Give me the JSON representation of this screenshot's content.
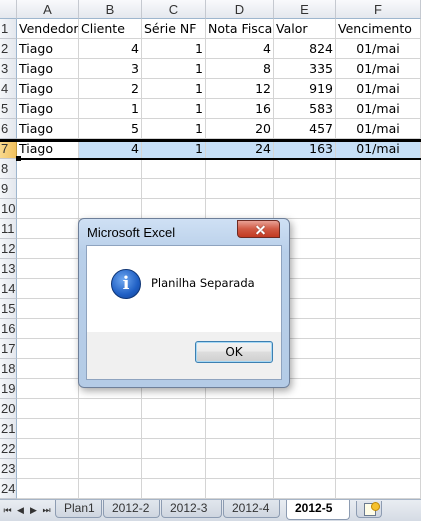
{
  "sheet": {
    "columns": [
      "A",
      "B",
      "C",
      "D",
      "E",
      "F"
    ],
    "row_numbers": [
      "1",
      "2",
      "3",
      "4",
      "5",
      "6",
      "7",
      "8",
      "9",
      "10",
      "11",
      "12",
      "13",
      "14",
      "15",
      "16",
      "17",
      "18",
      "19",
      "20",
      "21",
      "22",
      "23",
      "24"
    ],
    "header_row": [
      "Vendedor",
      "Cliente",
      "Série NF",
      "Nota Fisca",
      "Valor",
      "Vencimento"
    ],
    "data_rows": [
      [
        "Tiago",
        "4",
        "1",
        "4",
        "824",
        "01/mai"
      ],
      [
        "Tiago",
        "3",
        "1",
        "8",
        "335",
        "01/mai"
      ],
      [
        "Tiago",
        "2",
        "1",
        "12",
        "919",
        "01/mai"
      ],
      [
        "Tiago",
        "1",
        "1",
        "16",
        "583",
        "01/mai"
      ],
      [
        "Tiago",
        "5",
        "1",
        "20",
        "457",
        "01/mai"
      ],
      [
        "Tiago",
        "4",
        "1",
        "24",
        "163",
        "01/mai"
      ]
    ],
    "selected_row": "7",
    "selection_color": "#c6dff7"
  },
  "tabs": {
    "nav_icons": [
      "first-sheet-icon",
      "prev-sheet-icon",
      "next-sheet-icon",
      "last-sheet-icon"
    ],
    "nav_glyphs": [
      "⏮",
      "◀",
      "▶",
      "⏭"
    ],
    "items": [
      {
        "label": "Plan1",
        "active": false
      },
      {
        "label": "2012-2",
        "active": false
      },
      {
        "label": "2012-3",
        "active": false
      },
      {
        "label": "2012-4",
        "active": false
      },
      {
        "label": "2012-5",
        "active": true
      }
    ],
    "new_sheet_icon": "insert-worksheet-icon"
  },
  "dialog": {
    "title": "Microsoft Excel",
    "icon": "info-icon",
    "icon_glyph": "i",
    "message": "Planilha Separada",
    "ok_label": "OK",
    "close_icon": "close-icon"
  }
}
